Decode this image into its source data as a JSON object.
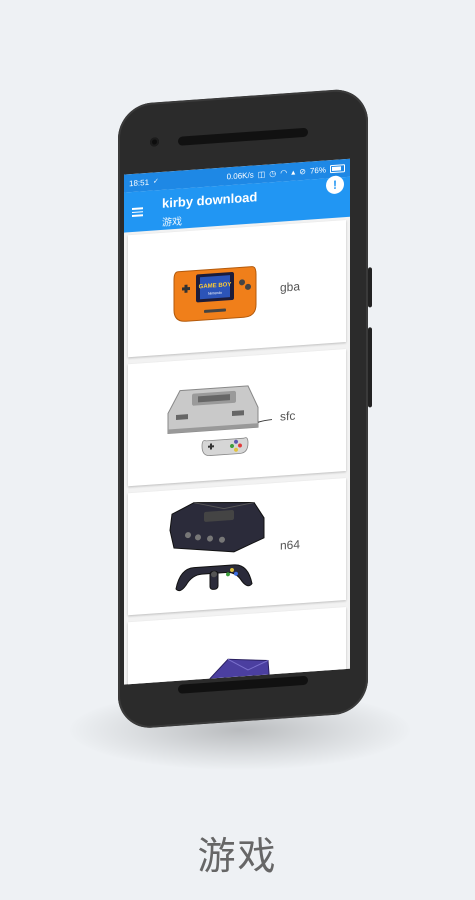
{
  "statusbar": {
    "time": "18:51",
    "net_speed": "0.06K/s",
    "battery": "76%"
  },
  "appbar": {
    "title": "kirby download",
    "subtitle": "游戏",
    "info_symbol": "!"
  },
  "games": [
    {
      "label": "gba",
      "icon": "gameboy-advance-icon"
    },
    {
      "label": "sfc",
      "icon": "super-famicom-icon"
    },
    {
      "label": "n64",
      "icon": "nintendo-64-icon"
    },
    {
      "label": "",
      "icon": "gamecube-icon"
    }
  ],
  "console_texts": {
    "gameboy_logo": "GAME BOY",
    "nintendo": "Nintendo"
  },
  "caption": "游戏",
  "colors": {
    "statusbar": "#1e88e5",
    "appbar": "#2196f3",
    "background": "#eef1f4"
  }
}
